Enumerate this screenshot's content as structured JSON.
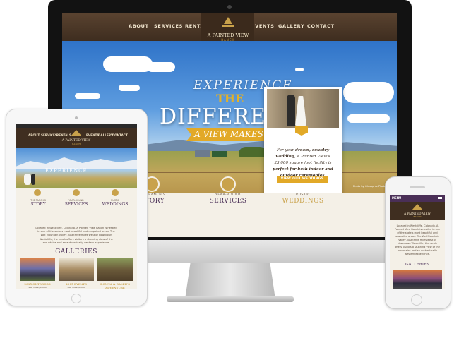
{
  "desktop": {
    "nav_left": [
      "ABOUT",
      "SERVICES",
      "RENTALS"
    ],
    "nav_right": [
      "EVENTS",
      "GALLERY",
      "CONTACT"
    ],
    "logo": {
      "name": "A PAINTED VIEW",
      "sub": "RANCH"
    },
    "hero": {
      "line1": "EXPERIENCE",
      "line2": "THE",
      "line3": "DIFFERENCE",
      "ribbon": "A VIEW MAKES"
    },
    "card": {
      "text_pre": "For your ",
      "text_em": "dream, country wedding",
      "text_mid": ", A Painted View's 23,000 square foot facility is ",
      "text_em2": "perfect for both indoor and outdoor ceremonies",
      "text_post": ".",
      "button": "VIEW OUR WEDDINGS"
    },
    "features": [
      {
        "small": "THE RANCH'S",
        "big": "STORY"
      },
      {
        "small": "YEAR-ROUND",
        "big": "SERVICES"
      },
      {
        "small": "RUSTIC",
        "big": "WEDDINGS"
      }
    ],
    "photo_credit": "Photo by Ohlsophie Photography"
  },
  "tablet": {
    "nav": [
      "ABOUT",
      "SERVICES",
      "RENTALS",
      "EVENTS",
      "GALLERY",
      "CONTACT"
    ],
    "logo": {
      "name": "A PAINTED VIEW",
      "sub": "RANCH"
    },
    "hero_text": "EXPERIENCE",
    "features": [
      {
        "small": "THE RANCH'S",
        "big": "STORY"
      },
      {
        "small": "YEAR-ROUND",
        "big": "SERVICES"
      },
      {
        "small": "RUSTIC",
        "big": "WEDDINGS"
      }
    ],
    "body": "Located in Westcliffe, Colorado, A Painted View Ranch is nestled in one of the state's most beautiful and unspoiled areas. The Wet Mountain Valley, just three miles west of downtown Westcliffe, the ranch offers visitors a stunning view of the mountains and an authentically western experience.",
    "galleries_title": "GALLERIES",
    "galleries": [
      {
        "label": "2015 OUTDOORS",
        "sub": "See more photos"
      },
      {
        "label": "2015 EVENTS",
        "sub": "See more photos"
      },
      {
        "label": "DONNA & RALPH'S ADVENTURE",
        "sub": ""
      }
    ]
  },
  "phone": {
    "menu": "MENU",
    "logo": {
      "name": "A PAINTED VIEW",
      "sub": "RANCH"
    },
    "body": "Located in Westcliffe, Colorado, A Painted View Ranch is nestled in one of the state's most beautiful and unspoiled areas. The Wet Mountain Valley, just three miles west of downtown Westcliffe, the ranch offers visitors a stunning view of the mountains and an authentically western experience.",
    "galleries_title": "GALLERIES"
  },
  "colors": {
    "brown": "#3e2d1f",
    "gold": "#e2a927",
    "purple": "#4a2f57",
    "cream": "#f4f0e7"
  }
}
